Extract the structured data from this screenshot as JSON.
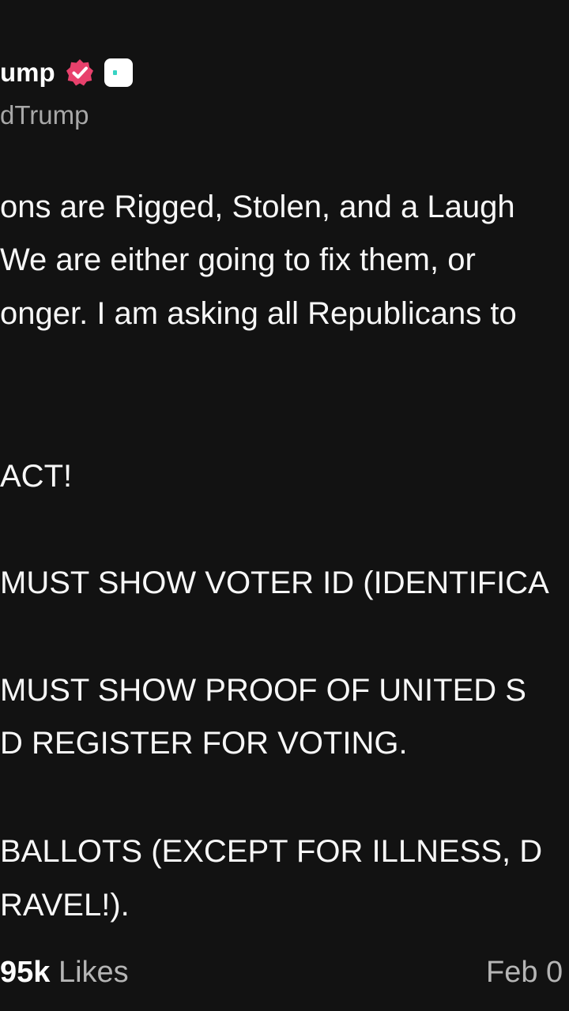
{
  "author": {
    "display_name": "ump",
    "handle": "dTrump",
    "verified_badge_color": "#e8416c",
    "app_badge_color": "#ffffff"
  },
  "post": {
    "lines": [
      "ons are Rigged, Stolen, and a Laugh",
      "We are either going to fix them, or",
      "onger. I am asking all Republicans to",
      "ACT!",
      "MUST SHOW VOTER ID (IDENTIFICA",
      "MUST SHOW PROOF OF UNITED S",
      "D REGISTER FOR VOTING.",
      "BALLOTS (EXCEPT FOR ILLNESS, D",
      "RAVEL!)."
    ]
  },
  "footer": {
    "likes_count": "95k",
    "likes_label": "Likes",
    "date": "Feb 0"
  }
}
